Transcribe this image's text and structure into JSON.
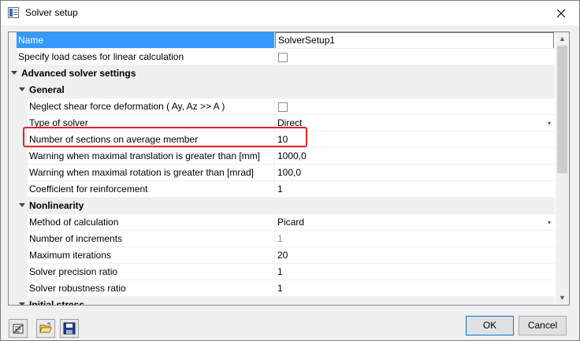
{
  "window": {
    "title": "Solver setup"
  },
  "grid": {
    "rows": [
      {
        "kind": "prop",
        "name": "Name",
        "value": "SolverSetup1",
        "editing": true,
        "selected": true
      },
      {
        "kind": "prop",
        "name": "Specify load cases for linear calculation",
        "value": "",
        "checkbox": true
      },
      {
        "kind": "cat",
        "level": 0,
        "name": "Advanced solver settings"
      },
      {
        "kind": "cat",
        "level": 1,
        "name": "General"
      },
      {
        "kind": "prop",
        "name": "Neglect shear force deformation ( Ay, Az >> A )",
        "value": "",
        "checkbox": true
      },
      {
        "kind": "prop",
        "name": "Type of solver",
        "value": "Direct",
        "dropdown": true
      },
      {
        "kind": "prop",
        "name": "Number of sections on average member",
        "value": "10",
        "highlighted": true
      },
      {
        "kind": "prop",
        "name": "Warning when maximal translation is greater than [mm]",
        "value": "1000,0"
      },
      {
        "kind": "prop",
        "name": "Warning when maximal rotation is greater than [mrad]",
        "value": "100,0"
      },
      {
        "kind": "prop",
        "name": "Coefficient for reinforcement",
        "value": "1"
      },
      {
        "kind": "cat",
        "level": 1,
        "name": "Nonlinearity"
      },
      {
        "kind": "prop",
        "name": "Method of calculation",
        "value": "Picard",
        "dropdown": true
      },
      {
        "kind": "prop",
        "name": "Number of increments",
        "value": "1",
        "greyed": true
      },
      {
        "kind": "prop",
        "name": "Maximum iterations",
        "value": "20"
      },
      {
        "kind": "prop",
        "name": "Solver precision ratio",
        "value": "1"
      },
      {
        "kind": "prop",
        "name": "Solver robustness ratio",
        "value": "1"
      },
      {
        "kind": "cat",
        "level": 1,
        "name": "Initial stress"
      }
    ],
    "scroll_position": 0.0
  },
  "toolbar": {
    "icons": [
      "clear-icon",
      "open-folder-icon",
      "save-icon"
    ]
  },
  "buttons": {
    "ok": "OK",
    "cancel": "Cancel"
  }
}
